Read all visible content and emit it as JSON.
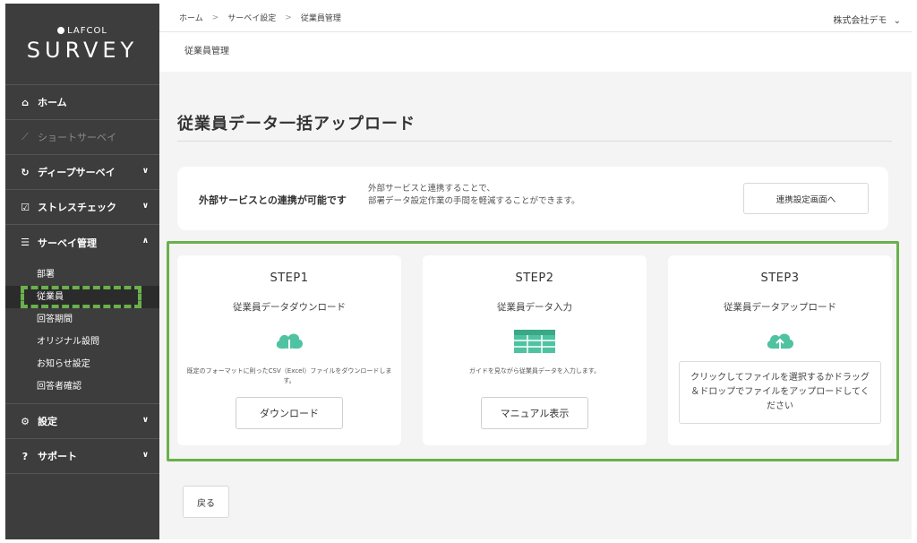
{
  "sidebar": {
    "logo_top": "LAFCOL",
    "logo_main": "SURVEY",
    "items": [
      {
        "label": "ホーム",
        "icon": "home-icon",
        "glyph": "⌂"
      },
      {
        "label": "ショートサーベイ",
        "icon": "trend-icon",
        "glyph": "⟋"
      },
      {
        "label": "ディープサーベイ",
        "icon": "loop-icon",
        "glyph": "↻"
      },
      {
        "label": "ストレスチェック",
        "icon": "checkbox-icon",
        "glyph": "☑"
      },
      {
        "label": "サーベイ管理",
        "icon": "sliders-icon",
        "glyph": "☰"
      },
      {
        "label": "設定",
        "icon": "gear-icon",
        "glyph": "⚙"
      },
      {
        "label": "サポート",
        "icon": "question-icon",
        "glyph": "?"
      }
    ],
    "sub_items": [
      "部署",
      "従業員",
      "回答期間",
      "オリジナル設問",
      "お知らせ設定",
      "回答者確認"
    ]
  },
  "topbar": {
    "breadcrumb": [
      "ホーム",
      "サーベイ設定",
      "従業員管理"
    ],
    "separator": ">",
    "company": "株式会社デモ",
    "company_chevron": "⌄"
  },
  "subheader": {
    "title": "従業員管理"
  },
  "main": {
    "title": "従業員データ一括アップロード",
    "integration": {
      "label": "外部サービスとの連携が可能です",
      "desc_line1": "外部サービスと連携することで、",
      "desc_line2": "部署データ設定作業の手間を軽減することができます。",
      "button": "連携設定画面へ"
    },
    "steps": [
      {
        "step": "STEP1",
        "title": "従業員データダウンロード",
        "note": "既定のフォーマットに則ったCSV（Excel）ファイルをダウンロードします。",
        "button": "ダウンロード"
      },
      {
        "step": "STEP2",
        "title": "従業員データ入力",
        "note": "ガイドを見ながら従業員データを入力します。",
        "button": "マニュアル表示"
      },
      {
        "step": "STEP3",
        "title": "従業員データアップロード",
        "dropzone": "クリックしてファイルを選択するかドラッグ＆ドロップでファイルをアップロードしてください"
      }
    ],
    "back_button": "戻る"
  },
  "colors": {
    "sidebar_bg": "#3d3d3d",
    "accent_green": "#6ab04c",
    "icon_teal": "#4fc3a1",
    "main_bg": "#f4f4f4"
  }
}
